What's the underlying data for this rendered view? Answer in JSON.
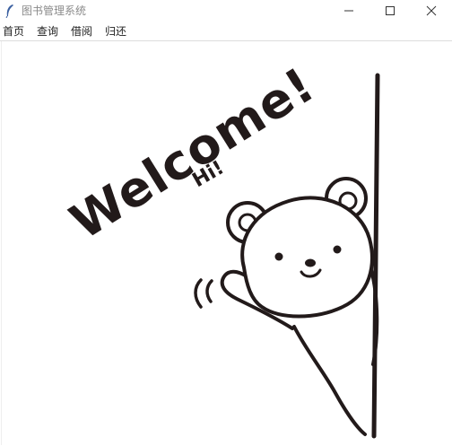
{
  "window": {
    "title": "图书管理系统",
    "icon": "feather-icon",
    "controls": [
      "minimize-icon",
      "maximize-icon",
      "close-icon"
    ]
  },
  "menu": {
    "items": [
      {
        "label": "首页"
      },
      {
        "label": "查询"
      },
      {
        "label": "借阅"
      },
      {
        "label": "归还"
      }
    ]
  },
  "illustration": {
    "welcome_text": "Welcome!",
    "hi_text": "Hi!",
    "ink_color": "#221a1a"
  }
}
